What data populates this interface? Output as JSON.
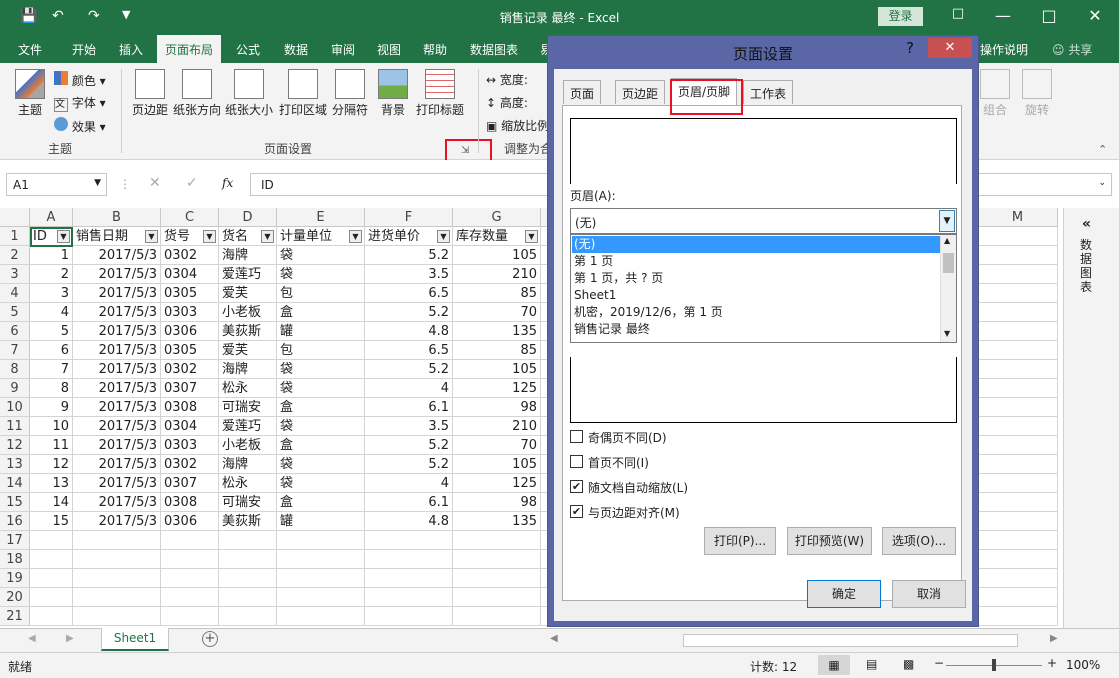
{
  "window": {
    "title": "销售记录 最终 - Excel",
    "login": "登录"
  },
  "tabs": [
    "文件",
    "开始",
    "插入",
    "页面布局",
    "公式",
    "数据",
    "审阅",
    "视图",
    "帮助",
    "数据图表",
    "易",
    "操作说明",
    "共享"
  ],
  "ribbon": {
    "theme": {
      "main": "主题",
      "colors": "颜色",
      "fonts": "字体",
      "effects": "效果",
      "group": "主题"
    },
    "setup": {
      "margins": "页边距",
      "orientation": "纸张方向",
      "size": "纸张大小",
      "print_area": "打印区域",
      "breaks": "分隔符",
      "background": "背景",
      "print_titles": "打印标题",
      "group": "页面设置"
    },
    "scale": {
      "width": "宽度:",
      "height": "高度:",
      "scale": "缩放比例",
      "group": "调整为合"
    },
    "arrange": {
      "group_btn": "组合",
      "rotate": "旋转"
    }
  },
  "formula_bar": {
    "name_box": "A1",
    "content": "ID",
    "fx": "fx"
  },
  "columns": [
    "A",
    "B",
    "C",
    "D",
    "E",
    "F",
    "G",
    "M"
  ],
  "headers": [
    "ID",
    "销售日期",
    "货号",
    "货名",
    "计量单位",
    "进货单价",
    "库存数量"
  ],
  "rows": [
    [
      "1",
      "2017/5/3",
      "0302",
      "海牌",
      "袋",
      "5.2",
      "105"
    ],
    [
      "2",
      "2017/5/3",
      "0304",
      "爱莲巧",
      "袋",
      "3.5",
      "210"
    ],
    [
      "3",
      "2017/5/3",
      "0305",
      "爱芙",
      "包",
      "6.5",
      "85"
    ],
    [
      "4",
      "2017/5/3",
      "0303",
      "小老板",
      "盒",
      "5.2",
      "70"
    ],
    [
      "5",
      "2017/5/3",
      "0306",
      "美荻斯",
      "罐",
      "4.8",
      "135"
    ],
    [
      "6",
      "2017/5/3",
      "0305",
      "爱芙",
      "包",
      "6.5",
      "85"
    ],
    [
      "7",
      "2017/5/3",
      "0302",
      "海牌",
      "袋",
      "5.2",
      "105"
    ],
    [
      "8",
      "2017/5/3",
      "0307",
      "松永",
      "袋",
      "4",
      "125"
    ],
    [
      "9",
      "2017/5/3",
      "0308",
      "可瑞安",
      "盒",
      "6.1",
      "98"
    ],
    [
      "10",
      "2017/5/3",
      "0304",
      "爱莲巧",
      "袋",
      "3.5",
      "210"
    ],
    [
      "11",
      "2017/5/3",
      "0303",
      "小老板",
      "盒",
      "5.2",
      "70"
    ],
    [
      "12",
      "2017/5/3",
      "0302",
      "海牌",
      "袋",
      "5.2",
      "105"
    ],
    [
      "13",
      "2017/5/3",
      "0307",
      "松永",
      "袋",
      "4",
      "125"
    ],
    [
      "14",
      "2017/5/3",
      "0308",
      "可瑞安",
      "盒",
      "6.1",
      "98"
    ],
    [
      "15",
      "2017/5/3",
      "0306",
      "美荻斯",
      "罐",
      "4.8",
      "135"
    ]
  ],
  "row_numbers": [
    "1",
    "2",
    "3",
    "4",
    "5",
    "6",
    "7",
    "8",
    "9",
    "10",
    "11",
    "12",
    "13",
    "14",
    "15",
    "16",
    "17",
    "18",
    "19",
    "20",
    "21"
  ],
  "sheet_tab": "Sheet1",
  "status": {
    "ready": "就绪",
    "count": "计数: 12",
    "zoom": "100%"
  },
  "right_pane": "数据图表",
  "dialog": {
    "title": "页面设置",
    "help": "?",
    "tabs": [
      "页面",
      "页边距",
      "页眉/页脚",
      "工作表"
    ],
    "header_label": "页眉(A):",
    "header_value": "(无)",
    "options": [
      "(无)",
      "第 1 页",
      "第 1 页，共 ? 页",
      "Sheet1",
      " 机密，2019/12/6，第 1 页",
      "销售记录 最终"
    ],
    "checks": [
      {
        "label": "奇偶页不同(D)",
        "checked": false
      },
      {
        "label": "首页不同(I)",
        "checked": false
      },
      {
        "label": "随文档自动缩放(L)",
        "checked": true
      },
      {
        "label": "与页边距对齐(M)",
        "checked": true
      }
    ],
    "buttons": {
      "print": "打印(P)...",
      "preview": "打印预览(W)",
      "options": "选项(O)...",
      "ok": "确定",
      "cancel": "取消"
    }
  },
  "colors": {
    "excel_green": "#217346",
    "dialog_frame": "#5a66a6",
    "highlight_red": "#e81123",
    "selection_blue": "#3399ff"
  }
}
